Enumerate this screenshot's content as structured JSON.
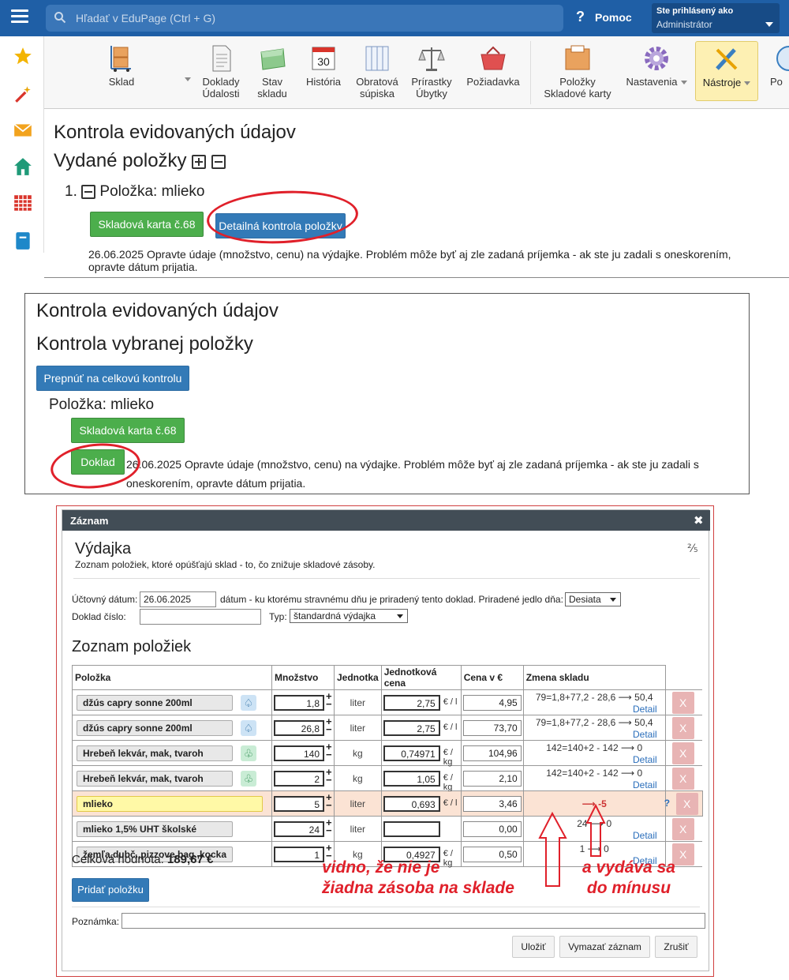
{
  "topbar": {
    "search_placeholder": "Hľadať v EduPage (Ctrl + G)",
    "help_label": "Pomoc",
    "login_line1": "Ste prihlásený ako",
    "login_line2": "Administrátor",
    "color": "#1f5fa6"
  },
  "sidebar": {
    "icons": [
      "star-icon",
      "magic-wand-icon",
      "envelope-icon",
      "home-icon",
      "timetable-icon",
      "notebook-icon"
    ]
  },
  "toolbar": {
    "items": [
      {
        "label": "Sklad",
        "icon": "warehouse-cart-icon"
      },
      {
        "label": "Doklady\nÚdalosti",
        "icon": "document-icon"
      },
      {
        "label": "Stav\nskladu",
        "icon": "box-icon"
      },
      {
        "label": "História",
        "icon": "calendar-icon"
      },
      {
        "label": "Obratová\nsúpiska",
        "icon": "ledger-icon"
      },
      {
        "label": "Prírastky\nÚbytky",
        "icon": "scales-icon"
      },
      {
        "label": "Požiadavka",
        "icon": "basket-icon"
      },
      {
        "label": "Položky\nSkladové karty",
        "icon": "package-icon"
      },
      {
        "label": "Nastavenia",
        "icon": "gear-icon"
      },
      {
        "label": "Nástroje",
        "icon": "tools-icon"
      },
      {
        "label": "Po",
        "icon": "help-circle-icon"
      }
    ],
    "calendar_day": "30"
  },
  "panel1": {
    "title": "Kontrola evidovaných údajov",
    "subtitle": "Vydané položky",
    "item_number": "1.",
    "item_label": "Položka: mlieko",
    "btn_card": "Skladová karta č.68",
    "btn_detail": "Detailná kontrola položky",
    "message": "26.06.2025 Opravte údaje (množstvo, cenu) na výdajke. Problém môže byť aj zle zadaná príjemka - ak ste ju zadali s oneskorením, opravte dátum prijatia."
  },
  "panel2": {
    "title": "Kontrola evidovaných údajov",
    "subtitle": "Kontrola vybranej položky",
    "btn_switch": "Prepnúť na celkovú kontrolu",
    "item_label": "Položka: mlieko",
    "btn_card": "Skladová karta č.68",
    "btn_doc": "Doklad",
    "message": "26.06.2025 Opravte údaje (množstvo, cenu) na výdajke. Problém môže byť aj zle zadaná príjemka - ak ste ju zadali s oneskorením, opravte dátum prijatia."
  },
  "dialog": {
    "header": "Záznam",
    "close": "✖",
    "title": "Výdajka",
    "page_indicator": "⅖",
    "description": "Zoznam položiek, ktoré opúšťajú sklad - to, čo znižuje skladové zásoby.",
    "date_label": "Účtovný dátum:",
    "date_value": "26.06.2025",
    "date_hint": "dátum - ku ktorému stravnému dňu je priradený tento doklad. Priradené jedlo dňa:",
    "meal_value": "Desiata",
    "doc_label": "Doklad číslo:",
    "doc_value": "",
    "type_label": "Typ:",
    "type_value": "štandardná výdajka",
    "list_title": "Zoznam položiek",
    "columns": [
      "Položka",
      "Množstvo",
      "Jednotka",
      "Jednotková cena",
      "Cena v €",
      "Zmena skladu"
    ],
    "rows": [
      {
        "name": "džús capry sonne 200ml",
        "suit": "♤",
        "qty": "1,8",
        "unit": "liter",
        "price": "2,75",
        "price_unit": "€ / l",
        "total": "4,95",
        "change": "79=1,8+77,2 - 28,6 ⟶ 50,4",
        "detail": "Detail",
        "x": "X"
      },
      {
        "name": "džús capry sonne 200ml",
        "suit": "♤",
        "qty": "26,8",
        "unit": "liter",
        "price": "2,75",
        "price_unit": "€ / l",
        "total": "73,70",
        "change": "79=1,8+77,2 - 28,6 ⟶ 50,4",
        "detail": "Detail",
        "x": "X"
      },
      {
        "name": "Hrebeň lekvár, mak, tvaroh",
        "suit": "♧",
        "qty": "140",
        "unit": "kg",
        "price": "0,74971",
        "price_unit": "€ / kg",
        "total": "104,96",
        "change": "142=140+2 - 142 ⟶ 0",
        "detail": "Detail",
        "x": "X"
      },
      {
        "name": "Hrebeň lekvár, mak, tvaroh",
        "suit": "♧",
        "qty": "2",
        "unit": "kg",
        "price": "1,05",
        "price_unit": "€ / kg",
        "total": "2,10",
        "change": "142=140+2 - 142 ⟶ 0",
        "detail": "Detail",
        "x": "X"
      },
      {
        "name": "mlieko",
        "suit": "",
        "qty": "5",
        "unit": "liter",
        "price": "0,693",
        "price_unit": "€ / l",
        "total": "3,46",
        "change": "⟶ -5",
        "detail": "",
        "x": "X",
        "q": "?"
      },
      {
        "name": "mlieko 1,5% UHT školské",
        "suit": "",
        "qty": "24",
        "unit": "liter",
        "price": "",
        "price_unit": "",
        "total": "0,00",
        "change": "24 ⟶ 0",
        "detail": "Detail",
        "x": "X"
      },
      {
        "name": "žemľa,dubč.,pizzove.bag.,kocka",
        "suit": "",
        "qty": "1",
        "unit": "kg",
        "price": "0,4927",
        "price_unit": "€ / kg",
        "total": "0,50",
        "change": "1 ⟶ 0",
        "detail": "Detail",
        "x": "X"
      }
    ],
    "total_label": "Celková hodnota:",
    "total_value": "189,67 €",
    "add_btn": "Pridať položku",
    "note_label": "Poznámka:",
    "note_value": "",
    "btn_save": "Uložiť",
    "btn_delete": "Vymazať záznam",
    "btn_cancel": "Zrušiť"
  },
  "annotations": {
    "left": "vidno, že nie je\nžiadna zásoba na sklade",
    "right": "a vydáva sa\ndo mínusu",
    "color": "#e0202a"
  }
}
